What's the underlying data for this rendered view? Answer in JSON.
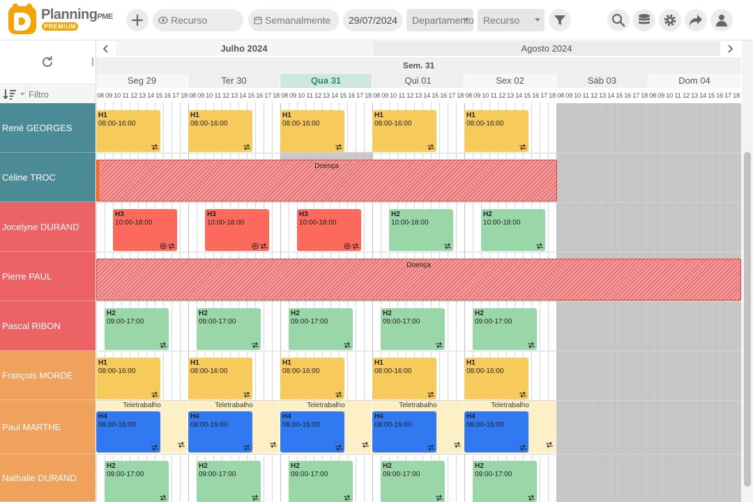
{
  "app": {
    "brand": "Planning",
    "brand_suffix": "PME",
    "edition": "PREMIUM"
  },
  "toolbar": {
    "resource_placeholder": "Recurso",
    "view_mode": "Semanalmente",
    "date": "29/07/2024",
    "department_placeholder": "Departamento",
    "resource_select_placeholder": "Recurso"
  },
  "sidebar": {
    "filter_placeholder": "Filtro"
  },
  "header": {
    "months": [
      "Julho 2024",
      "Agosto 2024"
    ],
    "week": "Sem. 31",
    "days": [
      "Seg 29",
      "Ter 30",
      "Qua 31",
      "Qui 01",
      "Sex 02",
      "Sáb 03",
      "Dom 04"
    ],
    "hours": [
      "08",
      "09",
      "10",
      "11",
      "12",
      "13",
      "14",
      "15",
      "16",
      "17",
      "18"
    ]
  },
  "resources": [
    {
      "name": "René GEORGES",
      "color": "#4a8b96"
    },
    {
      "name": "Céline TROC",
      "color": "#4a8b96"
    },
    {
      "name": "Jocelyne DURAND",
      "color": "#ed6265"
    },
    {
      "name": "Pierre PAUL",
      "color": "#ed6265"
    },
    {
      "name": "Pascal RIBON",
      "color": "#ed6265"
    },
    {
      "name": "François MORDE",
      "color": "#f0a15c"
    },
    {
      "name": "Paul MARTHE",
      "color": "#f0a15c"
    },
    {
      "name": "Nathalie DURAND",
      "color": "#f0a15c"
    }
  ],
  "shifts": {
    "H1": {
      "code": "H1",
      "time": "08:00-16:00"
    },
    "H2": {
      "code": "H2",
      "time": "09:00-17:00"
    },
    "H2b": {
      "code": "H2",
      "time": "10:00-18:00"
    },
    "H3": {
      "code": "H3",
      "time": "10:00-18:00"
    },
    "H4": {
      "code": "H4",
      "time": "08:00-16:00"
    }
  },
  "labels": {
    "sick_leave": "Doença",
    "telework": "Teletrabalho"
  },
  "colors": {
    "today": "#cfe8dd",
    "shift_h1": "#f6cb5c",
    "shift_h2": "#9ad7a8",
    "shift_h3": "#fb6a5c",
    "shift_h4": "#3079f1",
    "absence": "#e57373",
    "telework": "#fdf0c6"
  }
}
